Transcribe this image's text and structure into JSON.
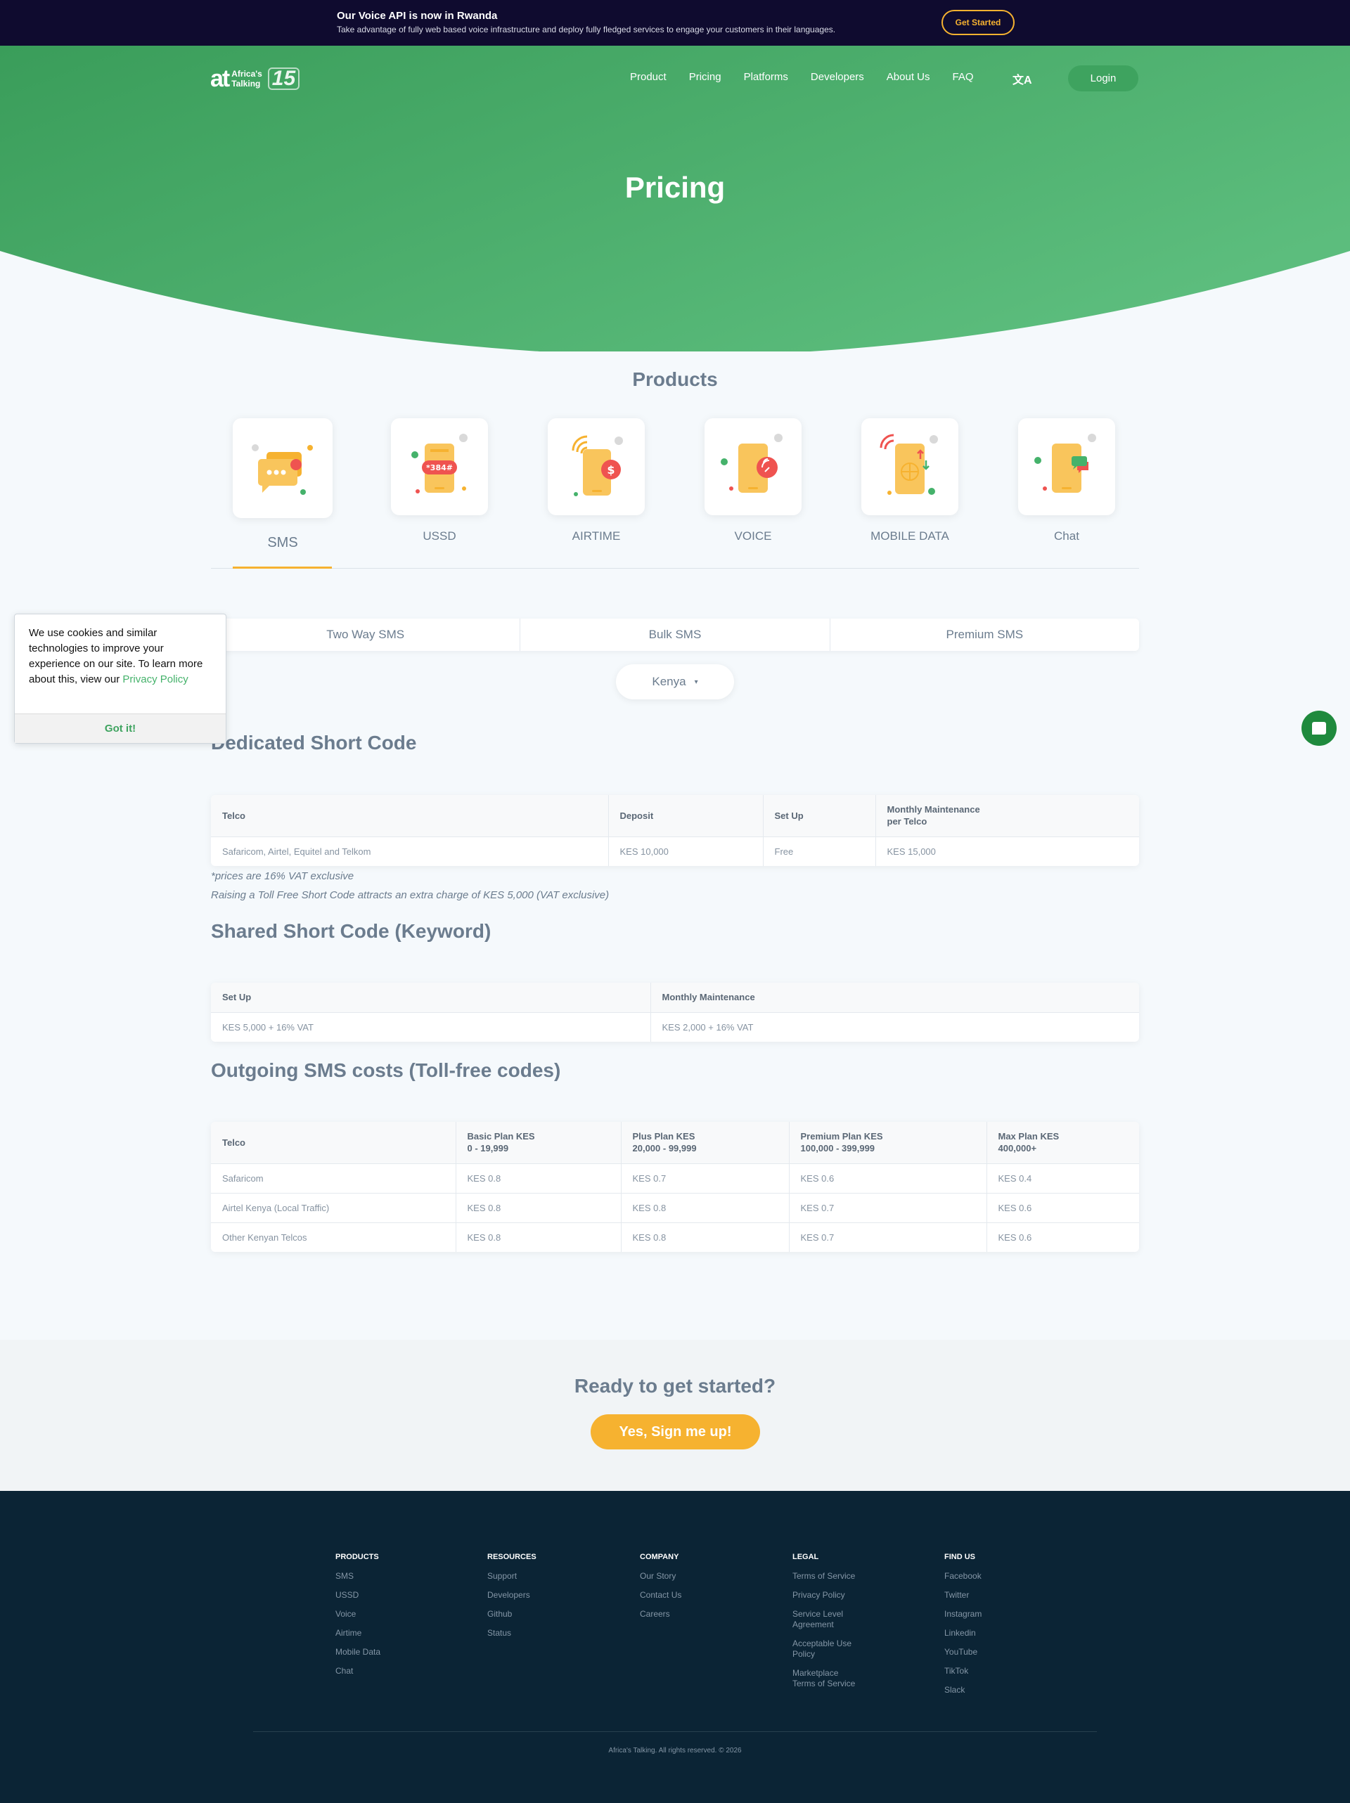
{
  "announcement": {
    "title": "Our Voice API is now in Rwanda",
    "subtitle": "Take advantage of fully web based voice infrastructure and deploy fully fledged services to engage your customers in their languages.",
    "cta": "Get Started"
  },
  "header": {
    "logo_mark": "at",
    "logo_text_line1": "Africa's",
    "logo_text_line2": "Talking",
    "logo_badge": "15",
    "nav": [
      "Product",
      "Pricing",
      "Platforms",
      "Developers",
      "About Us",
      "FAQ"
    ],
    "language_icon": "translate-icon",
    "login": "Login"
  },
  "hero": {
    "title": "Pricing"
  },
  "products": {
    "title": "Products",
    "items": [
      {
        "label": "SMS",
        "icon": "sms-icon",
        "active": true
      },
      {
        "label": "USSD",
        "icon": "ussd-icon",
        "badge": "*384#"
      },
      {
        "label": "AIRTIME",
        "icon": "airtime-icon",
        "badge": "$"
      },
      {
        "label": "VOICE",
        "icon": "voice-icon"
      },
      {
        "label": "MOBILE DATA",
        "icon": "mobile-data-icon"
      },
      {
        "label": "Chat",
        "icon": "chat-icon"
      }
    ]
  },
  "sms_tabs": [
    "Two Way SMS",
    "Bulk SMS",
    "Premium SMS"
  ],
  "country": {
    "selected": "Kenya",
    "caret": "▾"
  },
  "cookie": {
    "text": "We use cookies and similar technologies to improve your experience on our site. To learn more about this, view our ",
    "link": "Privacy Policy",
    "button": "Got it!"
  },
  "dedicated": {
    "title": "Dedicated Short Code",
    "headers": [
      "Telco",
      "Deposit",
      "Set Up",
      "Monthly Maintenance\nper Telco"
    ],
    "rows": [
      [
        "Safaricom, Airtel, Equitel and Telkom",
        "KES 10,000",
        "Free",
        "KES 15,000"
      ]
    ],
    "note1": "*prices are 16% VAT exclusive",
    "note2": "Raising a Toll Free Short Code attracts an extra charge of KES 5,000 (VAT exclusive)"
  },
  "shared": {
    "title": "Shared Short Code (Keyword)",
    "headers": [
      "Set Up",
      "Monthly Maintenance"
    ],
    "rows": [
      [
        "KES 5,000 + 16% VAT",
        "KES 2,000 + 16% VAT"
      ]
    ]
  },
  "outgoing": {
    "title": "Outgoing SMS costs (Toll-free codes)",
    "headers": [
      "Telco",
      "Basic Plan KES\n0 - 19,999",
      "Plus Plan KES\n20,000 - 99,999",
      "Premium Plan KES\n100,000 - 399,999",
      "Max Plan KES\n400,000+"
    ],
    "rows": [
      [
        "Safaricom",
        "KES 0.8",
        "KES 0.7",
        "KES 0.6",
        "KES 0.4"
      ],
      [
        "Airtel Kenya (Local Traffic)",
        "KES 0.8",
        "KES 0.8",
        "KES 0.7",
        "KES 0.6"
      ],
      [
        "Other Kenyan Telcos",
        "KES 0.8",
        "KES 0.8",
        "KES 0.7",
        "KES 0.6"
      ]
    ]
  },
  "cta": {
    "title": "Ready to get started?",
    "button": "Yes, Sign me up!"
  },
  "footer": {
    "columns": [
      {
        "title": "PRODUCTS",
        "links": [
          "SMS",
          "USSD",
          "Voice",
          "Airtime",
          "Mobile Data",
          "Chat"
        ]
      },
      {
        "title": "RESOURCES",
        "links": [
          "Support",
          "Developers",
          "Github",
          "Status"
        ]
      },
      {
        "title": "COMPANY",
        "links": [
          "Our Story",
          "Contact Us",
          "Careers"
        ]
      },
      {
        "title": "LEGAL",
        "links": [
          "Terms of Service",
          "Privacy Policy",
          "Service Level\nAgreement",
          "Acceptable Use\nPolicy",
          "Marketplace\nTerms of Service"
        ]
      },
      {
        "title": "FIND US",
        "links": [
          "Facebook",
          "Twitter",
          "Instagram",
          "Linkedin",
          "YouTube",
          "TikTok",
          "Slack"
        ]
      }
    ],
    "copyright": "Africa's Talking. All rights reserved. © 2026"
  },
  "colors": {
    "accent_green": "#3ea35f",
    "accent_orange": "#f6b230",
    "announce_bg": "#0f0b2f",
    "footer_bg": "#0b2435"
  },
  "chat_widget": {
    "icon": "chat-widget-icon"
  }
}
